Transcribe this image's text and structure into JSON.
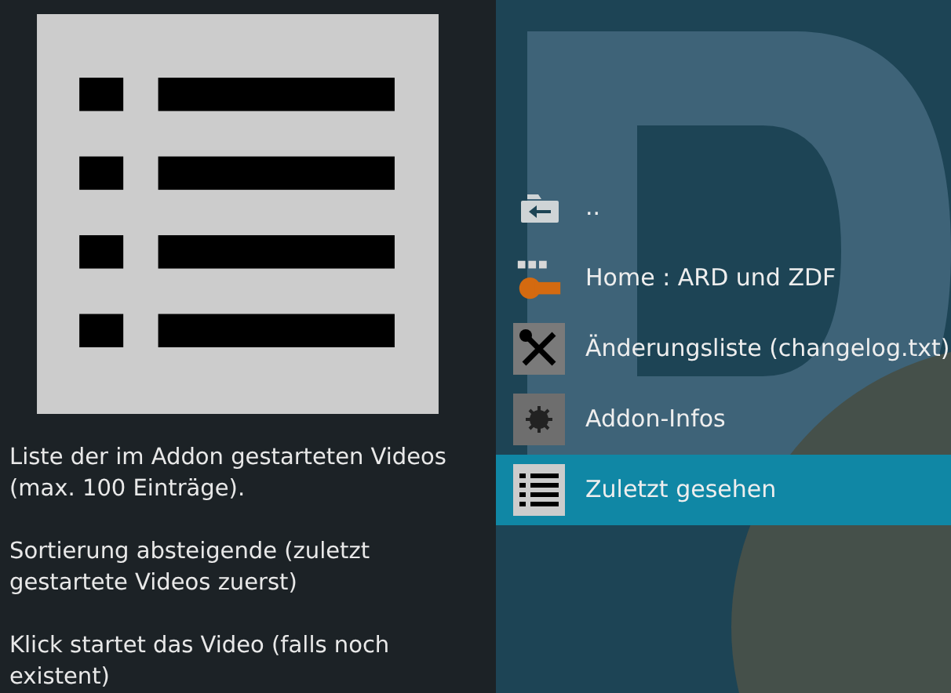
{
  "description": [
    "Liste der im Addon gestarteten Videos (max. 100 Einträge).",
    "Sortierung absteigende (zuletzt gestartete Videos zuerst)",
    "Klick startet das Video (falls noch existent)"
  ],
  "items": [
    {
      "kind": "parent",
      "label": "..",
      "selected": false
    },
    {
      "kind": "logo",
      "label": "Home : ARD und ZDF",
      "selected": false
    },
    {
      "kind": "tools",
      "label": "Änderungsliste (changelog.txt)",
      "selected": false
    },
    {
      "kind": "gear",
      "label": "Addon-Infos",
      "selected": false
    },
    {
      "kind": "list",
      "label": "Zuletzt gesehen",
      "selected": true
    }
  ]
}
